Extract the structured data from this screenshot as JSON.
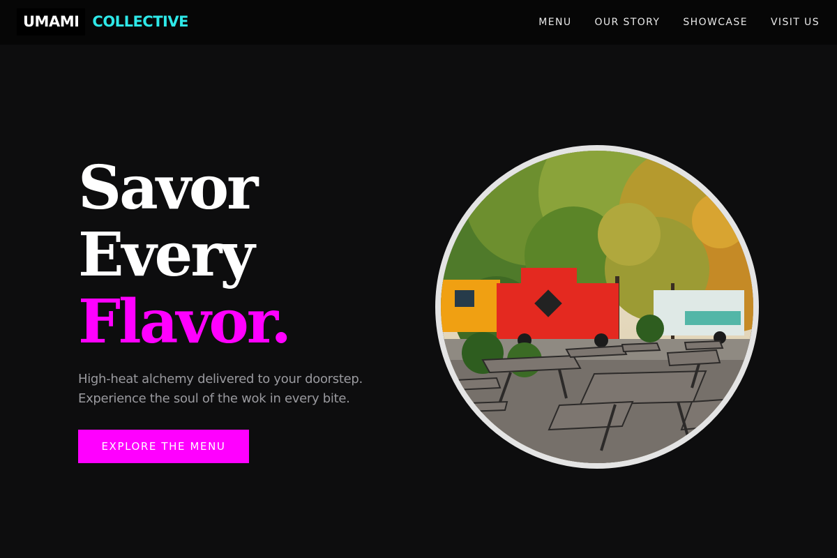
{
  "brand": {
    "primary": "UMAMI",
    "secondary": "COLLECTIVE"
  },
  "nav": {
    "items": [
      "MENU",
      "OUR STORY",
      "SHOWCASE",
      "VISIT US"
    ]
  },
  "hero": {
    "heading_line1": "Savor",
    "heading_line2": "Every",
    "heading_accent": "Flavor.",
    "sub_line1": "High-heat alchemy delivered to your doorstep.",
    "sub_line2": "Experience the soul of the wok in every bite.",
    "cta_label": "EXPLORE THE MENU"
  },
  "image": {
    "subject": "food trucks parked behind picnic tables under autumn trees",
    "shape": "circle"
  },
  "colors": {
    "background": "#0d0d0e",
    "header": "#060606",
    "accent": "#ff00ff",
    "logo_accent": "#2ee8e8",
    "subtext": "#9a9a9f"
  }
}
